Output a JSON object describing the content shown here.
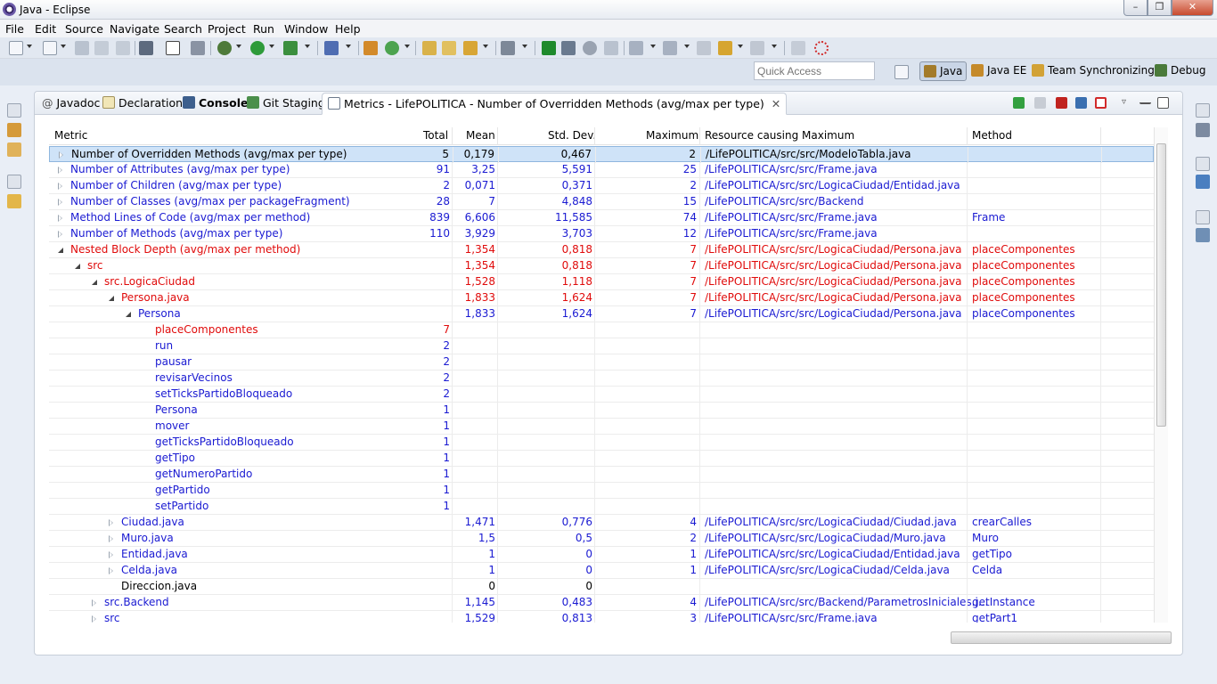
{
  "window": {
    "title": "Java - Eclipse"
  },
  "menu": [
    "File",
    "Edit",
    "Source",
    "Navigate",
    "Search",
    "Project",
    "Run",
    "Window",
    "Help"
  ],
  "quick_access": {
    "placeholder": "Quick Access"
  },
  "perspectives": [
    "Java",
    "Java EE",
    "Team Synchronizing",
    "Debug"
  ],
  "tabs": [
    {
      "label": "Javadoc",
      "icon": "at-icon"
    },
    {
      "label": "Declaration",
      "icon": "declaration-icon"
    },
    {
      "label": "Console",
      "icon": "console-icon"
    },
    {
      "label": "Git Staging",
      "icon": "git-staging-icon"
    },
    {
      "label": "Metrics - LifePOLITICA - Number of Overridden Methods (avg/max per type)",
      "icon": "metrics-icon"
    }
  ],
  "table": {
    "headers": [
      "Metric",
      "Total",
      "Mean",
      "Std. Dev.",
      "Maximum",
      "Resource causing Maximum",
      "Method"
    ],
    "rows": [
      {
        "metric": "Number of Overridden Methods (avg/max per type)",
        "total": "5",
        "mean": "0,179",
        "std": "0,467",
        "max": "2",
        "resource": "/LifePOLITICA/src/src/ModeloTabla.java",
        "method": ""
      },
      {
        "metric": "Number of Attributes (avg/max per type)",
        "total": "91",
        "mean": "3,25",
        "std": "5,591",
        "max": "25",
        "resource": "/LifePOLITICA/src/src/Frame.java",
        "method": ""
      },
      {
        "metric": "Number of Children (avg/max per type)",
        "total": "2",
        "mean": "0,071",
        "std": "0,371",
        "max": "2",
        "resource": "/LifePOLITICA/src/src/LogicaCiudad/Entidad.java",
        "method": ""
      },
      {
        "metric": "Number of Classes (avg/max per packageFragment)",
        "total": "28",
        "mean": "7",
        "std": "4,848",
        "max": "15",
        "resource": "/LifePOLITICA/src/src/Backend",
        "method": ""
      },
      {
        "metric": "Method Lines of Code (avg/max per method)",
        "total": "839",
        "mean": "6,606",
        "std": "11,585",
        "max": "74",
        "resource": "/LifePOLITICA/src/src/Frame.java",
        "method": "Frame"
      },
      {
        "metric": "Number of Methods (avg/max per type)",
        "total": "110",
        "mean": "3,929",
        "std": "3,703",
        "max": "12",
        "resource": "/LifePOLITICA/src/src/Frame.java",
        "method": ""
      },
      {
        "metric": "Nested Block Depth (avg/max per method)",
        "total": "",
        "mean": "1,354",
        "std": "0,818",
        "max": "7",
        "resource": "/LifePOLITICA/src/src/LogicaCiudad/Persona.java",
        "method": "placeComponentes"
      },
      {
        "metric": "src",
        "total": "",
        "mean": "1,354",
        "std": "0,818",
        "max": "7",
        "resource": "/LifePOLITICA/src/src/LogicaCiudad/Persona.java",
        "method": "placeComponentes"
      },
      {
        "metric": "src.LogicaCiudad",
        "total": "",
        "mean": "1,528",
        "std": "1,118",
        "max": "7",
        "resource": "/LifePOLITICA/src/src/LogicaCiudad/Persona.java",
        "method": "placeComponentes"
      },
      {
        "metric": "Persona.java",
        "total": "",
        "mean": "1,833",
        "std": "1,624",
        "max": "7",
        "resource": "/LifePOLITICA/src/src/LogicaCiudad/Persona.java",
        "method": "placeComponentes"
      },
      {
        "metric": "Persona",
        "total": "",
        "mean": "1,833",
        "std": "1,624",
        "max": "7",
        "resource": "/LifePOLITICA/src/src/LogicaCiudad/Persona.java",
        "method": "placeComponentes"
      },
      {
        "metric": "placeComponentes",
        "total": "7",
        "mean": "",
        "std": "",
        "max": "",
        "resource": "",
        "method": ""
      },
      {
        "metric": "run",
        "total": "2",
        "mean": "",
        "std": "",
        "max": "",
        "resource": "",
        "method": ""
      },
      {
        "metric": "pausar",
        "total": "2",
        "mean": "",
        "std": "",
        "max": "",
        "resource": "",
        "method": ""
      },
      {
        "metric": "revisarVecinos",
        "total": "2",
        "mean": "",
        "std": "",
        "max": "",
        "resource": "",
        "method": ""
      },
      {
        "metric": "setTicksPartidoBloqueado",
        "total": "2",
        "mean": "",
        "std": "",
        "max": "",
        "resource": "",
        "method": ""
      },
      {
        "metric": "Persona",
        "total": "1",
        "mean": "",
        "std": "",
        "max": "",
        "resource": "",
        "method": ""
      },
      {
        "metric": "mover",
        "total": "1",
        "mean": "",
        "std": "",
        "max": "",
        "resource": "",
        "method": ""
      },
      {
        "metric": "getTicksPartidoBloqueado",
        "total": "1",
        "mean": "",
        "std": "",
        "max": "",
        "resource": "",
        "method": ""
      },
      {
        "metric": "getTipo",
        "total": "1",
        "mean": "",
        "std": "",
        "max": "",
        "resource": "",
        "method": ""
      },
      {
        "metric": "getNumeroPartido",
        "total": "1",
        "mean": "",
        "std": "",
        "max": "",
        "resource": "",
        "method": ""
      },
      {
        "metric": "getPartido",
        "total": "1",
        "mean": "",
        "std": "",
        "max": "",
        "resource": "",
        "method": ""
      },
      {
        "metric": "setPartido",
        "total": "1",
        "mean": "",
        "std": "",
        "max": "",
        "resource": "",
        "method": ""
      },
      {
        "metric": "Ciudad.java",
        "total": "",
        "mean": "1,471",
        "std": "0,776",
        "max": "4",
        "resource": "/LifePOLITICA/src/src/LogicaCiudad/Ciudad.java",
        "method": "crearCalles"
      },
      {
        "metric": "Muro.java",
        "total": "",
        "mean": "1,5",
        "std": "0,5",
        "max": "2",
        "resource": "/LifePOLITICA/src/src/LogicaCiudad/Muro.java",
        "method": "Muro"
      },
      {
        "metric": "Entidad.java",
        "total": "",
        "mean": "1",
        "std": "0",
        "max": "1",
        "resource": "/LifePOLITICA/src/src/LogicaCiudad/Entidad.java",
        "method": "getTipo"
      },
      {
        "metric": "Celda.java",
        "total": "",
        "mean": "1",
        "std": "0",
        "max": "1",
        "resource": "/LifePOLITICA/src/src/LogicaCiudad/Celda.java",
        "method": "Celda"
      },
      {
        "metric": "Direccion.java",
        "total": "",
        "mean": "0",
        "std": "0",
        "max": "",
        "resource": "",
        "method": ""
      },
      {
        "metric": "src.Backend",
        "total": "",
        "mean": "1,145",
        "std": "0,483",
        "max": "4",
        "resource": "/LifePOLITICA/src/src/Backend/ParametrosIniciales.j...",
        "method": "getInstance"
      },
      {
        "metric": "src",
        "total": "",
        "mean": "1,529",
        "std": "0,813",
        "max": "3",
        "resource": "/LifePOLITICA/src/src/Frame.java",
        "method": "getPart1"
      }
    ]
  },
  "colors": {
    "blue_text": "#1a1ad2",
    "red_text": "#e00b0b",
    "selection": "#cfe3f8"
  }
}
